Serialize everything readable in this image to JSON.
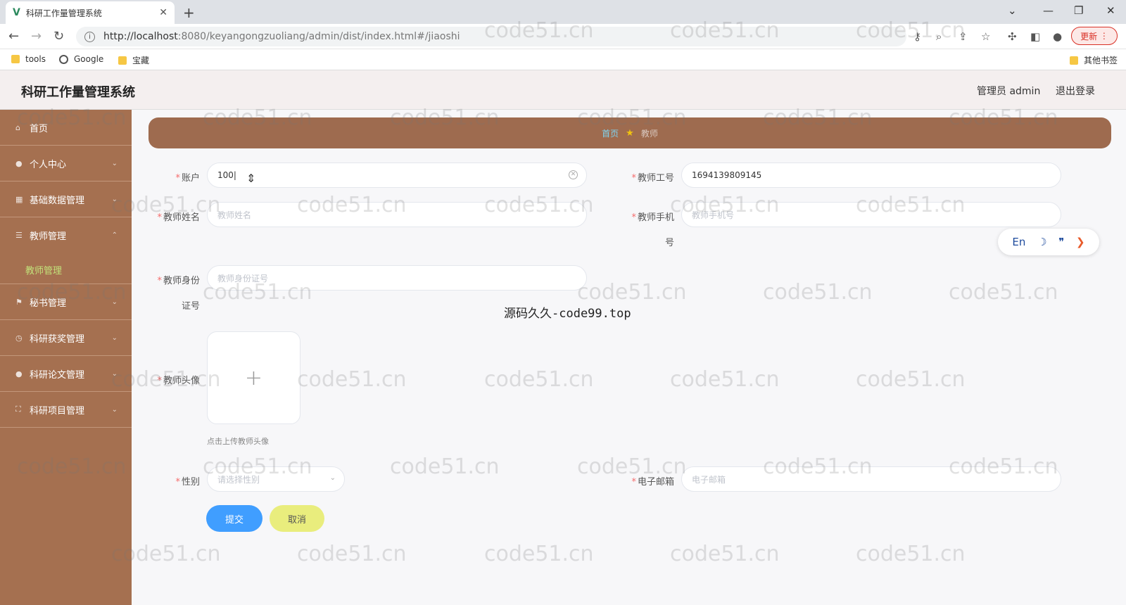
{
  "browser": {
    "tab_title": "科研工作量管理系统",
    "url_host": "http://localhost",
    "url_rest": ":8080/keyangongzuoliang/admin/dist/index.html#/jiaoshi",
    "update_label": "更新",
    "bookmarks": [
      "tools",
      "Google",
      "宝藏"
    ],
    "other_bookmarks": "其他书签"
  },
  "header": {
    "title": "科研工作量管理系统",
    "admin": "管理员 admin",
    "logout": "退出登录"
  },
  "sidebar": {
    "items": [
      {
        "label": "首页"
      },
      {
        "label": "个人中心"
      },
      {
        "label": "基础数据管理"
      },
      {
        "label": "教师管理"
      },
      {
        "label": "秘书管理"
      },
      {
        "label": "科研获奖管理"
      },
      {
        "label": "科研论文管理"
      },
      {
        "label": "科研项目管理"
      }
    ],
    "active_sub": "教师管理"
  },
  "breadcrumb": {
    "home": "首页",
    "current": "教师"
  },
  "form": {
    "account_label": "账户",
    "account_value": "100",
    "teacher_no_label": "教师工号",
    "teacher_no_value": "1694139809145",
    "name_label": "教师姓名",
    "name_placeholder": "教师姓名",
    "phone_label_1": "教师手机",
    "phone_label_2": "号",
    "phone_placeholder": "教师手机号",
    "idcard_label_1": "教师身份",
    "idcard_label_2": "证号",
    "idcard_placeholder": "教师身份证号",
    "avatar_label": "教师头像",
    "avatar_tip": "点击上传教师头像",
    "gender_label": "性别",
    "gender_placeholder": "请选择性别",
    "email_label": "电子邮箱",
    "email_placeholder": "电子邮箱",
    "submit": "提交",
    "cancel": "取消"
  },
  "lang_widget": {
    "label": "En"
  },
  "watermark": {
    "text": "code51.cn",
    "center": "源码久久-code99.top"
  }
}
